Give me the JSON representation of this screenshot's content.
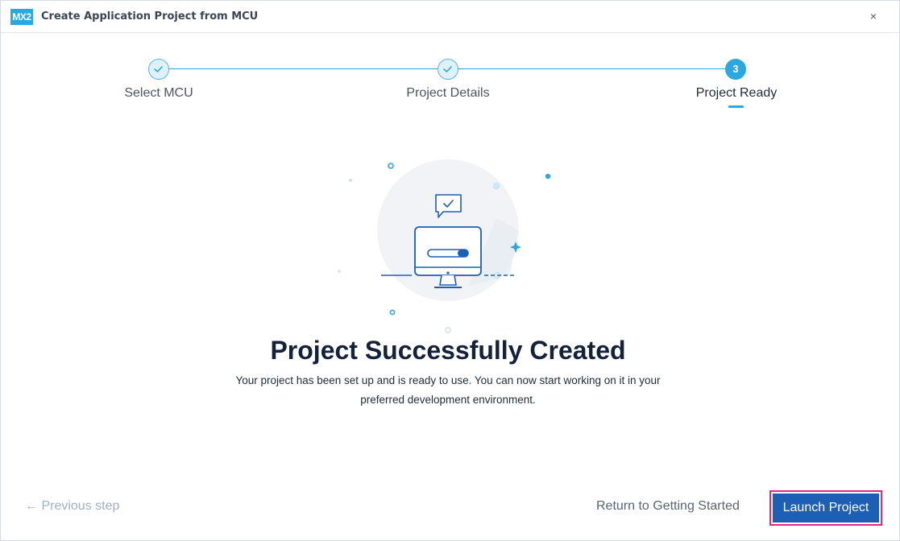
{
  "window": {
    "logo_text": "MX2",
    "title": "Create Application Project from MCU",
    "close_glyph": "×"
  },
  "stepper": {
    "steps": [
      {
        "label": "Select MCU",
        "state": "completed",
        "icon": "check-icon"
      },
      {
        "label": "Project Details",
        "state": "completed",
        "icon": "check-icon"
      },
      {
        "label": "Project Ready",
        "state": "active",
        "number": "3"
      }
    ],
    "accent_color": "#2aa8e0"
  },
  "main": {
    "illustration": "monitor-with-checkmark-illustration",
    "headline": "Project Successfully Created",
    "message_line1": "Your project has been set up and is ready to use. You can now start working on it in your",
    "message_line2": "preferred development environment."
  },
  "footer": {
    "previous_label": "← Previous step",
    "return_label": "Return to Getting Started",
    "launch_label": "Launch Project",
    "launch_color": "#1d5fb5",
    "highlight_color": "#e8247d"
  }
}
